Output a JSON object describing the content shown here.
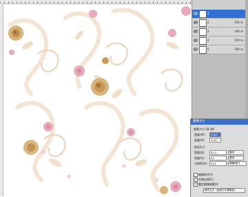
{
  "layers_panel": {
    "layers": [
      {
        "name": "1",
        "size": "",
        "selected": true
      },
      {
        "name": "2",
        "size": "194 m"
      },
      {
        "name": "3",
        "size": "194 m"
      },
      {
        "name": "4",
        "size": "194 m"
      },
      {
        "name": "5",
        "size": "194 m"
      }
    ]
  },
  "image_size_dialog": {
    "title": "图像大小",
    "pixel_size": "像素大小:28.5M",
    "width_label": "宽度(W):",
    "width_value": "3300",
    "height_label": "高度(H):",
    "height_value": "3300",
    "doc_size_label": "文档大小:",
    "doc_width_label": "宽度(D):",
    "doc_width_value": "92.5",
    "doc_height_label": "高度(G):",
    "doc_height_value": "93",
    "resolution_label": "分辨率(R):",
    "resolution_value": "254",
    "unit_cm": "厘米",
    "unit_px_in": "像素/英寸",
    "scale_styles": "缩放样式(Y)",
    "constrain": "约束比例(C)",
    "resample": "重定图像像素(I):",
    "resample_method": "两次立方（适用于平滑渐变）"
  },
  "colors": {
    "leaf": "#f1dcc4",
    "rose_gold": "#d7b47a",
    "rose_pink": "#e6a8b9",
    "selection_blue": "#2f6fd6"
  }
}
